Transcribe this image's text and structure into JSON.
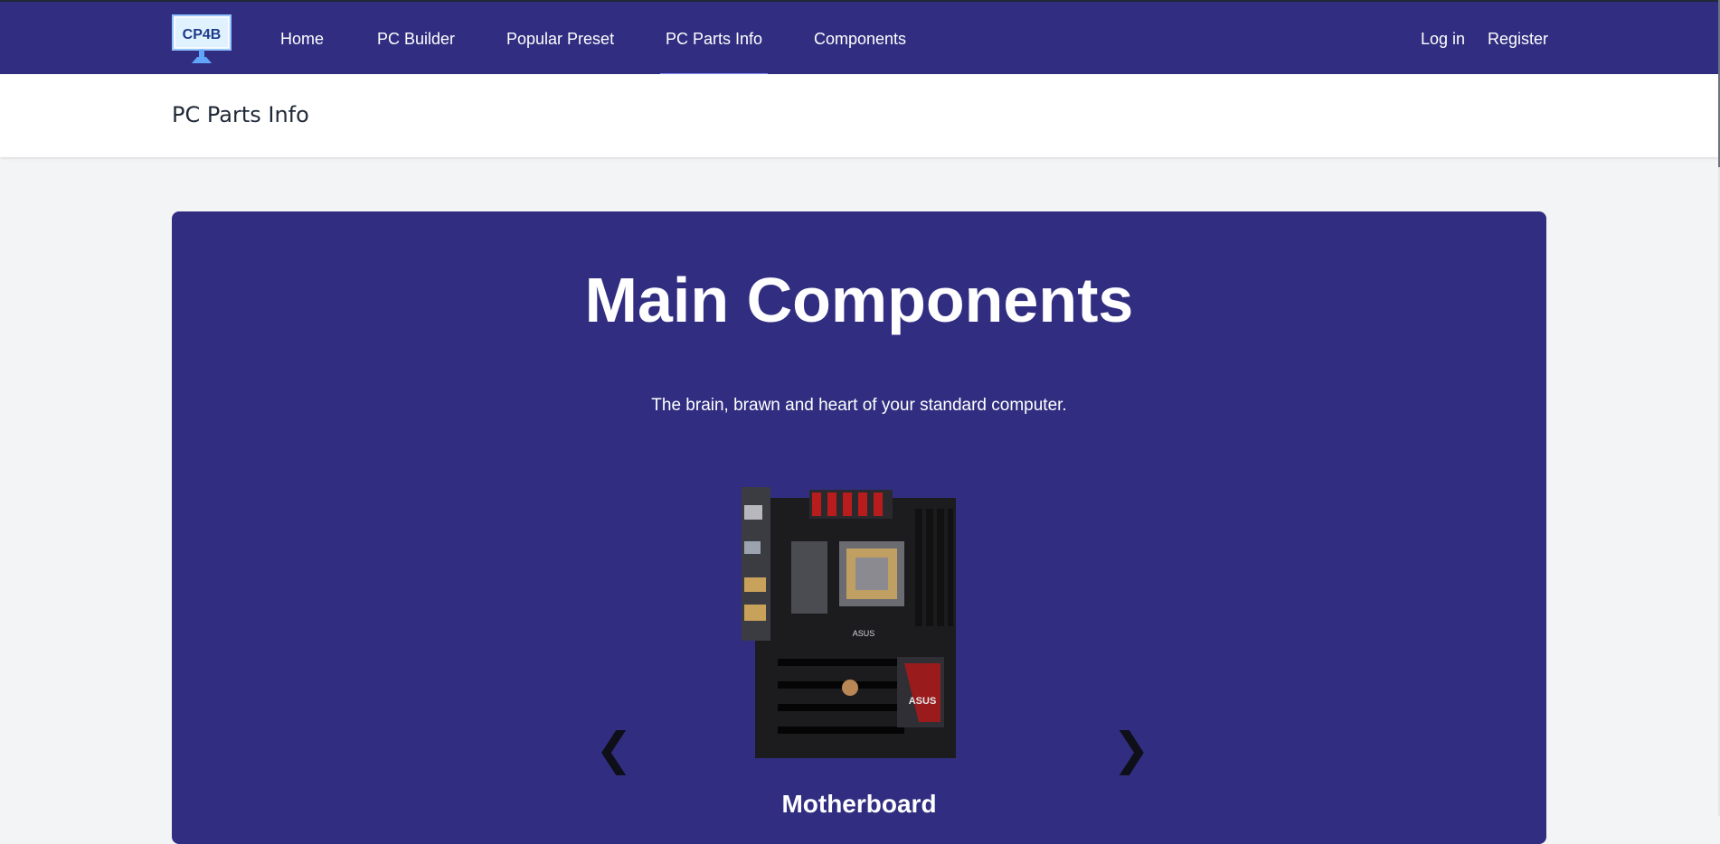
{
  "brand": {
    "logo_text": "CP4B"
  },
  "nav": {
    "items": [
      {
        "label": "Home"
      },
      {
        "label": "PC Builder"
      },
      {
        "label": "Popular Preset"
      },
      {
        "label": "PC Parts Info"
      },
      {
        "label": "Components"
      }
    ],
    "active": "PC Parts Info",
    "login_label": "Log in",
    "register_label": "Register"
  },
  "header": {
    "title": "PC Parts Info"
  },
  "hero": {
    "title": "Main Components",
    "subtitle": "The brain, brawn and heart of your standard computer.",
    "carousel": {
      "prev_icon": "❮",
      "next_icon": "❯",
      "current_item": "Motherboard",
      "current_image_brand": "ASUS"
    }
  },
  "colors": {
    "primary": "#312e81",
    "accent_underline": "#818cf8",
    "page_bg": "#f3f4f6"
  }
}
